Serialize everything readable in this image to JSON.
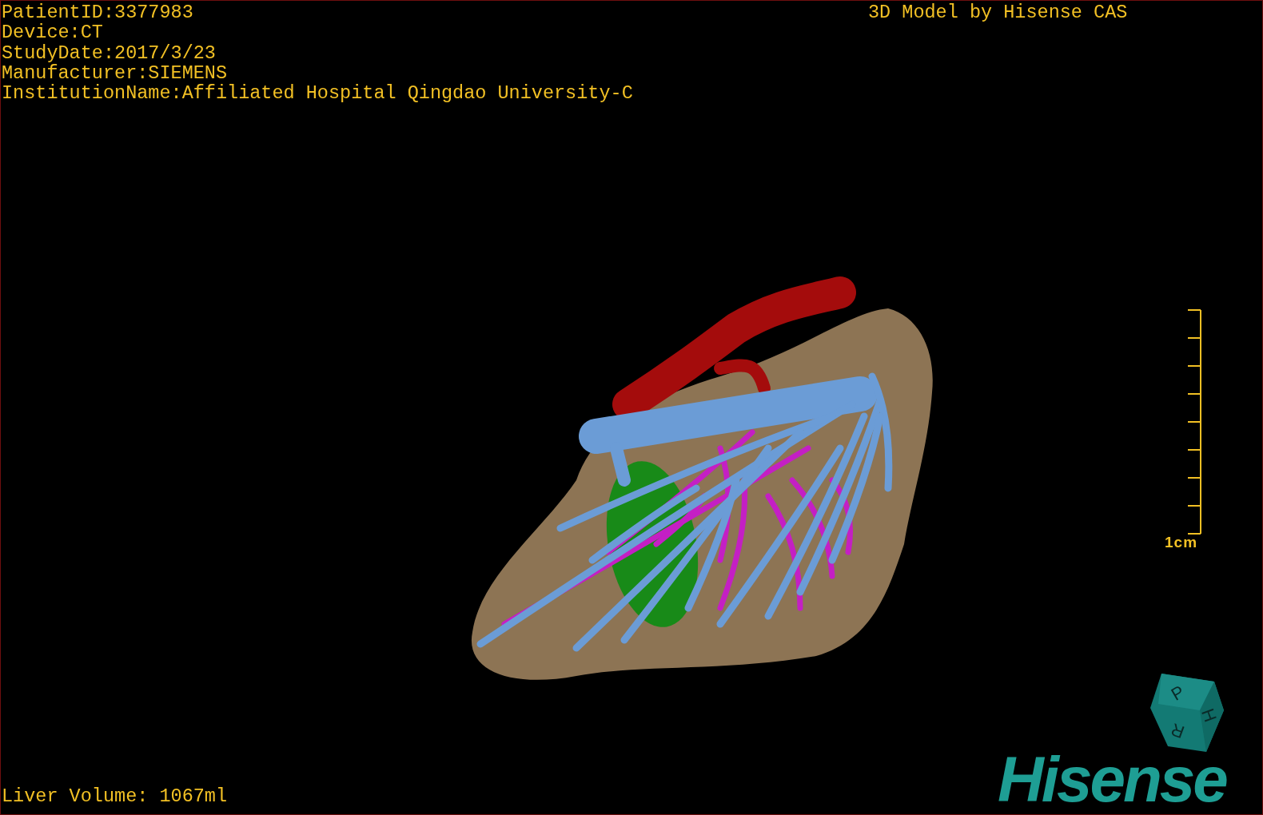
{
  "viewport": {
    "info_lines": [
      "PatientID:3377983",
      "Device:CT",
      "StudyDate:2017/3/23",
      "Manufacturer:SIEMENS",
      "InstitutionName:Affiliated Hospital Qingdao University-C"
    ],
    "title": "3D Model by Hisense CAS",
    "scale_bar": {
      "label": "1cm"
    },
    "orientation_cube": {
      "faces": [
        "P",
        "H",
        "R"
      ]
    },
    "logo": "Hisense",
    "footer": "Liver Volume: 1067ml"
  }
}
